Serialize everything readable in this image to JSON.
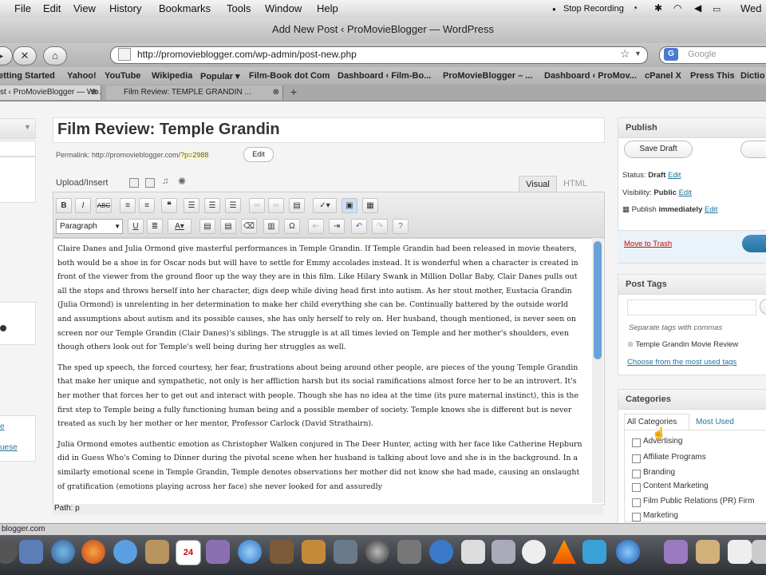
{
  "menubar": {
    "items": [
      "File",
      "Edit",
      "View",
      "History",
      "Bookmarks",
      "Tools",
      "Window",
      "Help"
    ],
    "stop_recording": "Stop Recording",
    "clock": "Wed"
  },
  "window": {
    "title": "Add New Post ‹ ProMovieBlogger — WordPress"
  },
  "navigation": {
    "url": "http://promovieblogger.com/wp-admin/post-new.php",
    "search_placeholder": "Google"
  },
  "bookmarks": [
    "etting Started",
    "Yahoo!",
    "YouTube",
    "Wikipedia",
    "Popular ▾",
    "Film-Book dot Com",
    "Dashboard ‹ Film-Bo...",
    "ProMovieBlogger – ...",
    "Dashboard ‹ ProMov...",
    "cPanel X",
    "Press This",
    "Dictio"
  ],
  "tabs": [
    {
      "label": "st ‹ ProMovieBlogger — Wo..."
    },
    {
      "label": "Film Review: TEMPLE GRANDIN ..."
    }
  ],
  "post": {
    "title": "Film Review: Temple Grandin",
    "permalink_label": "Permalink: http://promovieblogger.com/",
    "permalink_id": "?p=2988",
    "edit_label": "Edit",
    "upload_label": "Upload/Insert",
    "tab_visual": "Visual",
    "tab_html": "HTML",
    "format_label": "Paragraph",
    "path_label": "Path: p",
    "paragraphs": [
      "Claire Danes and Julia Ormond give masterful performances in Temple Grandin. If Temple Grandin had been released in movie theaters, both would be a shoe in for Oscar nods but will have to settle for Emmy accolades instead. It is wonderful when a character is created in front of the viewer from the ground floor up the way they are in this film. Like Hilary Swank in Million Dollar Baby, Clair Danes pulls out all the stops and throws herself into her character, digs deep while diving head first into autism. As her stout mother, Eustacia Grandin (Julia Ormond) is unrelenting in her determination to make her child everything she can be. Continually battered by the outside world and assumptions about autism and its possible causes, she has only herself to rely on. Her husband, though mentioned, is never seen on screen nor our Temple Grandin (Clair Danes)'s siblings. The struggle is at all times levied on Temple and her mother's shoulders, even though others look out for Temple's well being during her struggles as well.",
      "The sped up speech, the forced courtesy, her fear, frustrations about being around other people, are pieces of the young Temple Grandin that make her unique and sympathetic, not only is her affliction harsh but its social ramifications almost force her to be an introvert. It's her mother that forces her to get out and interact with people. Though she has no idea at the time (its pure maternal instinct), this is the first step to Temple being a fully functioning human being and a possible member of society. Temple knows she is different but is never treated as such by her mother or her mentor, Professor Carlock (David Strathairn).",
      "Julia Ormond emotes authentic emotion as Christopher Walken conjured in The Deer Hunter, acting with her face like Catherine Hepburn did in Guess Who's Coming to Dinner during the pivotal scene when her husband is talking about love and she is in the background. In a similarly emotional scene in Temple Grandin, Temple denotes observations her mother did not know she had made, causing an onslaught of gratification (emotions playing across her face) she never looked for and assuredly"
    ]
  },
  "publish": {
    "header": "Publish",
    "save_draft": "Save Draft",
    "status_label": "Status: ",
    "status_value": "Draft",
    "visibility_label": "Visibility: ",
    "visibility_value": "Public",
    "publish_label": "Publish ",
    "publish_value": "immediately",
    "edit": "Edit",
    "move_to_trash": "Move to Trash"
  },
  "tags": {
    "header": "Post Tags",
    "hint": "Separate tags with commas",
    "tag": "Temple Grandin Movie Review",
    "choose": "Choose from the most used tags"
  },
  "categories": {
    "header": "Categories",
    "tab_all": "All Categories",
    "tab_most": "Most Used",
    "items": [
      "Advertising",
      "Affiliate Programs",
      "Branding",
      "Content Marketing",
      "Film Public Relations (PR) Firm",
      "Marketing"
    ]
  },
  "statusbar": {
    "text": "blogger.com"
  },
  "left_panel": {
    "link1": "e",
    "link2": "uese"
  }
}
